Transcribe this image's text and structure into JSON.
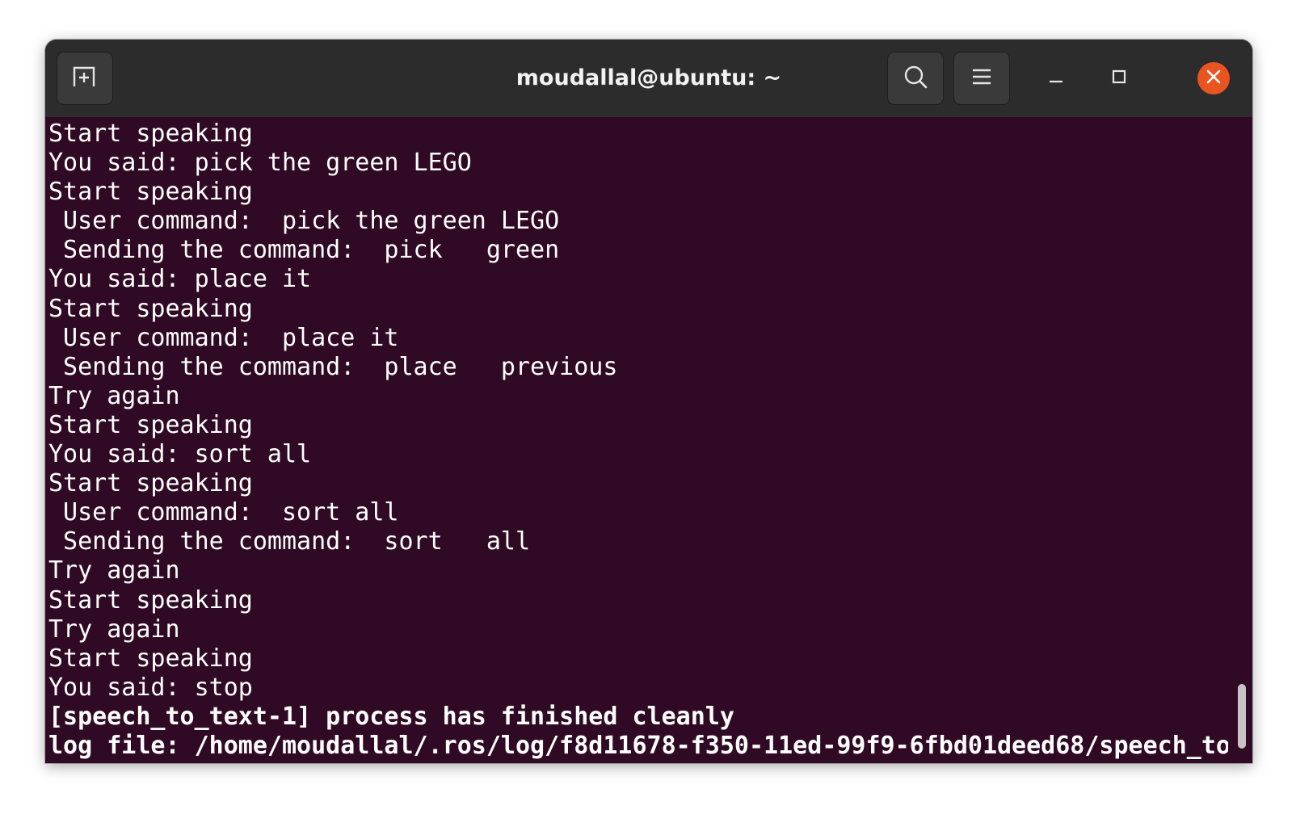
{
  "window": {
    "title": "moudallal@ubuntu: ~"
  },
  "toolbar": {
    "new_tab_icon": "new-tab-icon",
    "search_icon": "search-icon",
    "menu_icon": "hamburger-menu-icon",
    "minimize_icon": "minimize-icon",
    "maximize_icon": "maximize-icon",
    "close_icon": "close-icon"
  },
  "colors": {
    "terminal_background": "#300a24",
    "titlebar_background": "#2c2c2c",
    "close_accent": "#e95420",
    "text": "#ffffff"
  },
  "terminal": {
    "lines": [
      "Start speaking",
      "You said: pick the green LEGO",
      "Start speaking",
      " User command:  pick the green LEGO",
      " Sending the command:  pick   green",
      "You said: place it",
      "Start speaking",
      " User command:  place it",
      " Sending the command:  place   previous",
      "Try again",
      "Start speaking",
      "You said: sort all",
      "Start speaking",
      " User command:  sort all",
      " Sending the command:  sort   all",
      "Try again",
      "Start speaking",
      "Try again",
      "Start speaking",
      "You said: stop",
      "[speech_to_text-1] process has finished cleanly",
      "log file: /home/moudallal/.ros/log/f8d11678-f350-11ed-99f9-6fbd01deed68/speech_to"
    ]
  }
}
